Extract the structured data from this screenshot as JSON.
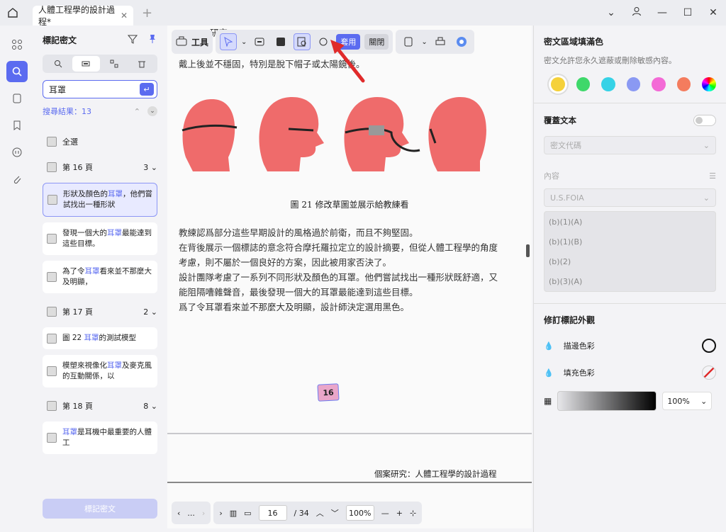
{
  "titlebar": {
    "tab_title": "人體工程學的設計過程*",
    "close": "✕",
    "add": "+"
  },
  "leftpanel": {
    "title": "標記密文",
    "search_value": "耳罩",
    "result_label": "搜尋結果：13",
    "select_all": "全選",
    "pages": [
      {
        "label": "第 16 頁",
        "count": "3"
      },
      {
        "label": "第 17 頁",
        "count": "2"
      },
      {
        "label": "第 18 頁",
        "count": "8"
      }
    ],
    "cards": [
      {
        "pre": "形狀及顏色的",
        "hit": "耳罩",
        "post": "，他們嘗試找出一種形狀"
      },
      {
        "pre": "發現一個大的",
        "hit": "耳罩",
        "post": "最能達到這些目標。"
      },
      {
        "pre": "為了令",
        "hit": "耳罩",
        "post": "看來並不那麼大及明顯，"
      },
      {
        "pre": "圖 22 ",
        "hit": "耳罩",
        "post": "的測試模型"
      },
      {
        "pre": "模塑來視像化",
        "hit": "耳罩",
        "post": "及麥克風的互動關係，以"
      },
      {
        "pre": "",
        "hit": "耳罩",
        "post": "是耳機中最重要的人體工"
      }
    ],
    "mark_button": "標記密文"
  },
  "toolbar": {
    "tools_label": "工具",
    "apply": "套用",
    "close": "關閉"
  },
  "document": {
    "top_lines": [
      "研究",
      "戴上後並不穩固，特別是脫下帽子或太陽鏡後。"
    ],
    "caption": "圖 21  修改草圖並展示給教練看",
    "para": [
      "教練認爲部分這些早期設計的風格過於前衛，而且不夠堅固。",
      "在背後展示一個標誌的意念符合摩托羅拉定立的設計摘要，但從人體工程學的角度",
      "考慮，則不屬於一個良好的方案，因此被用家否決了。",
      "設計團隊考慮了一系列不同形狀及顏色的耳罩。他們嘗試找出一種形狀既舒適，又",
      "能阻隔嘈雜聲音，最後發現一個大的耳罩最能達到這些目標。",
      "爲了令耳罩看來並不那麼大及明顯，設計師決定選用黑色。"
    ],
    "page_badge": "16",
    "footer_title": "個案研究：人體工程學的設計過程"
  },
  "bottombar": {
    "page": "16",
    "total": "/ 34",
    "zoom": "100%",
    "more": "..."
  },
  "rightpanel": {
    "fill_title": "密文區域填滿色",
    "fill_desc": "密文允許您永久遮蔽或刪除敏感內容。",
    "colors": [
      "#f5d13a",
      "#3ed86a",
      "#36d2e6",
      "#8a99f3",
      "#f36ad6",
      "#f47c5e"
    ],
    "overlay_label": "覆蓋文本",
    "overlay_select": "密文代碼",
    "content_label": "內容",
    "content_select": "U.S.FOIA",
    "codes": [
      "(b)(1)(A)",
      "(b)(1)(B)",
      "(b)(2)",
      "(b)(3)(A)"
    ],
    "appearance_title": "修訂標記外觀",
    "stroke_label": "描邊色彩",
    "fill_label": "填充色彩",
    "opacity": "100%"
  },
  "colors": {
    "accent": "#5b6bf0",
    "head": "#ef6b6b"
  }
}
